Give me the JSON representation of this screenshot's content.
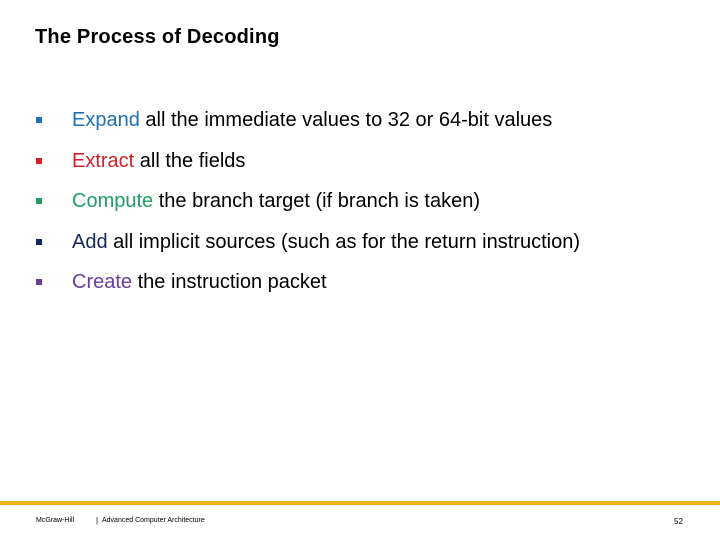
{
  "slide": {
    "title": "The Process of Decoding",
    "bullets": [
      {
        "keyword": "Expand",
        "rest": " all the immediate values to 32 or 64-bit values",
        "color": "#1f6fb2"
      },
      {
        "keyword": "Extract",
        "rest": " all the fields",
        "color": "#d0202a"
      },
      {
        "keyword": "Compute",
        "rest": " the branch target (if branch is taken)",
        "color": "#1e9e64"
      },
      {
        "keyword": "Add",
        "rest": " all implicit sources (such as for the return instruction)",
        "color": "#13285a"
      },
      {
        "keyword": "Create",
        "rest": " the instruction packet",
        "color": "#6a3d9a"
      }
    ]
  },
  "footer": {
    "brand": "McGraw-Hill",
    "separator": "|",
    "course": "Advanced Computer Architecture",
    "page_number": "52",
    "rule_color": "#f0b41c"
  }
}
